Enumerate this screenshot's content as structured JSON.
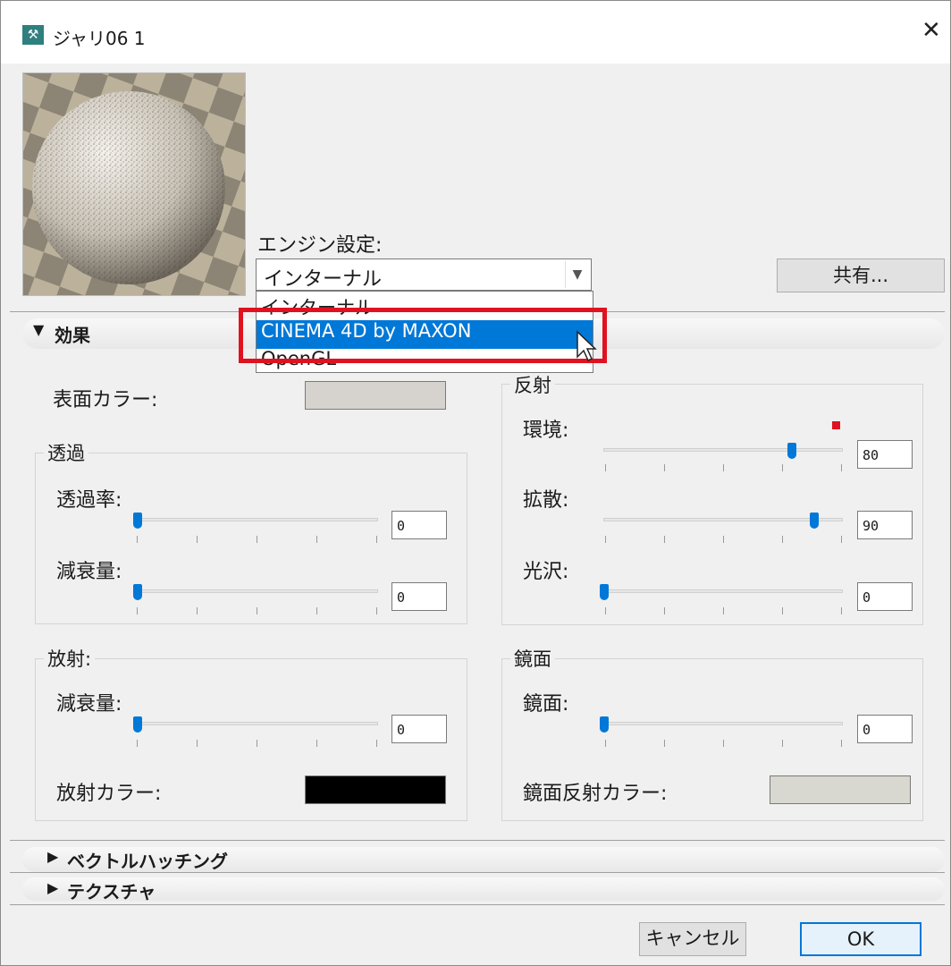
{
  "window": {
    "title": "ジャリ06 1",
    "icon": "material-icon",
    "close": "✕"
  },
  "engine": {
    "label": "エンジン設定:",
    "selected": "インターナル",
    "options": [
      "インターナル",
      "CINEMA 4D by MAXON",
      "OpenGL"
    ],
    "highlighted_option": "CINEMA 4D by MAXON"
  },
  "share_button": "共有...",
  "sections": {
    "effects": "効果",
    "vector_hatching": "ベクトルハッチング",
    "texture": "テクスチャ"
  },
  "surface_color": {
    "label": "表面カラー:",
    "color": "#d6d3ce"
  },
  "transparency": {
    "title": "透過",
    "rate": {
      "label": "透過率:",
      "value": "0"
    },
    "falloff": {
      "label": "減衰量:",
      "value": "0"
    }
  },
  "emission": {
    "title": "放射:",
    "falloff": {
      "label": "減衰量:",
      "value": "0"
    },
    "color_label": "放射カラー:",
    "color": "#000000"
  },
  "reflection": {
    "title": "反射",
    "environment": {
      "label": "環境:",
      "value": "80"
    },
    "diffuse": {
      "label": "拡散:",
      "value": "90"
    },
    "gloss": {
      "label": "光沢:",
      "value": "0"
    }
  },
  "specular": {
    "title": "鏡面",
    "specular": {
      "label": "鏡面:",
      "value": "0"
    },
    "color_label": "鏡面反射カラー:",
    "color": "#d8d8d0"
  },
  "buttons": {
    "cancel": "キャンセル",
    "ok": "OK"
  },
  "colors": {
    "accent": "#0078d7",
    "annotation": "#e0121f"
  }
}
